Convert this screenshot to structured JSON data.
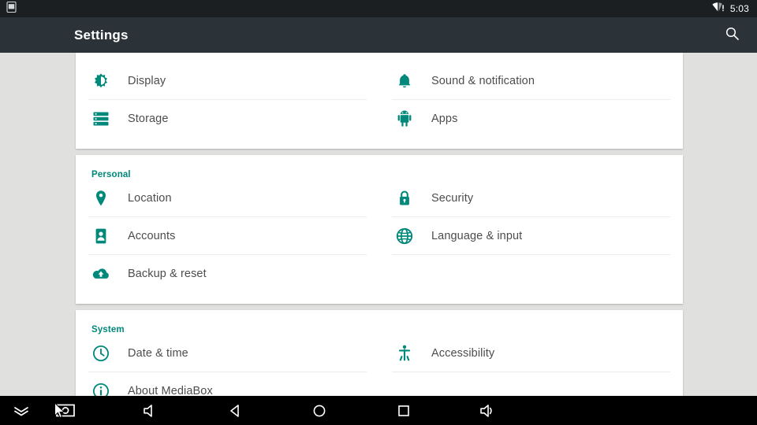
{
  "status_bar": {
    "left_icons": [
      {
        "name": "screenshot-icon",
        "label": "Screenshot"
      }
    ],
    "right_icons": [
      {
        "name": "wifi-no-internet-icon",
        "label": "Wi-Fi no internet"
      }
    ],
    "clock": "5:03"
  },
  "app_bar": {
    "title": "Settings",
    "search_icon_label": "Search"
  },
  "colors": {
    "accent": "#00897b",
    "app_bar_bg": "#2b3238",
    "status_bar_bg": "#1b1f22",
    "page_bg": "#e0e0de",
    "card_bg": "#ffffff",
    "label_text": "#4d4d4d",
    "divider": "#ececec",
    "nav_bar_bg": "#000000"
  },
  "cards": [
    {
      "header": null,
      "items": [
        {
          "icon": "brightness-icon",
          "label": "Display"
        },
        {
          "icon": "bell-icon",
          "label": "Sound & notification"
        },
        {
          "icon": "storage-icon",
          "label": "Storage"
        },
        {
          "icon": "android-robot-icon",
          "label": "Apps"
        }
      ]
    },
    {
      "header": "Personal",
      "items": [
        {
          "icon": "location-pin-icon",
          "label": "Location"
        },
        {
          "icon": "lock-icon",
          "label": "Security"
        },
        {
          "icon": "account-icon",
          "label": "Accounts"
        },
        {
          "icon": "globe-icon",
          "label": "Language & input"
        },
        {
          "icon": "cloud-upload-icon",
          "label": "Backup & reset"
        },
        {
          "icon": null,
          "label": ""
        }
      ]
    },
    {
      "header": "System",
      "items": [
        {
          "icon": "clock-icon",
          "label": "Date & time"
        },
        {
          "icon": "accessibility-icon",
          "label": "Accessibility"
        },
        {
          "icon": "info-icon",
          "label": "About MediaBox"
        },
        {
          "icon": null,
          "label": ""
        }
      ]
    }
  ],
  "nav_bar": {
    "buttons": [
      {
        "name": "collapse-icon",
        "label": "Hide navigation"
      },
      {
        "name": "screenshot-icon",
        "label": "Take screenshot"
      },
      {
        "name": "volume-down-icon",
        "label": "Volume down"
      },
      {
        "name": "back-icon",
        "label": "Back"
      },
      {
        "name": "home-icon",
        "label": "Home"
      },
      {
        "name": "recents-icon",
        "label": "Recent apps"
      },
      {
        "name": "volume-up-icon",
        "label": "Volume up"
      }
    ]
  }
}
